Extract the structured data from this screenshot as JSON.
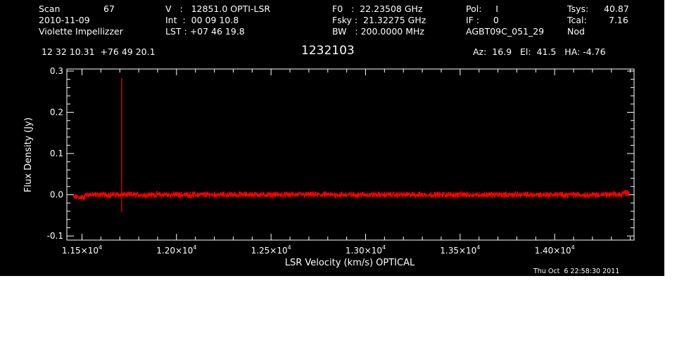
{
  "header": {
    "scan_label": "Scan",
    "scan_value": "67",
    "date": "2010-11-09",
    "observer": "Violette Impellizzer",
    "v_line": "V   :   12851.0 OPTI-LSR",
    "int_line": "Int  :  00 09 10.8",
    "lst_line": "LST : +07 46 19.8",
    "f0_line": "F0   :  22.23508 GHz",
    "fsky_line": "Fsky :  21.32275 GHz",
    "bw_line": "BW   : 200.0000 MHz",
    "pol_line": "Pol:     I",
    "if_line": "IF :     0",
    "project": "AGBT09C_051_29",
    "tsys_label": "Tsys:",
    "tsys_value": "40.87",
    "tcal_label": "Tcal:",
    "tcal_value": "7.16",
    "mode": "Nod",
    "coords": "12 32 10.31  +76 49 20.1",
    "source": "1232103",
    "azelha": "Az:  16.9   El:  41.5   HA: -4.76",
    "timestamp": "Thu Oct  6 22:58:30 2011"
  },
  "chart_data": {
    "type": "line",
    "title": "1232103",
    "xlabel": "LSR Velocity (km/s) OPTICAL",
    "ylabel": "Flux Density (Jy)",
    "xlim": [
      11420,
      14420
    ],
    "ylim": [
      -0.11,
      0.305
    ],
    "x_ticks": [
      {
        "value": 11500,
        "mantissa": "1.15",
        "exp": "4"
      },
      {
        "value": 12000,
        "mantissa": "1.20",
        "exp": "4"
      },
      {
        "value": 12500,
        "mantissa": "1.25",
        "exp": "4"
      },
      {
        "value": 13000,
        "mantissa": "1.30",
        "exp": "4"
      },
      {
        "value": 13500,
        "mantissa": "1.35",
        "exp": "4"
      },
      {
        "value": 14000,
        "mantissa": "1.40",
        "exp": "4"
      }
    ],
    "y_ticks": [
      {
        "value": 0.3,
        "label": "0.3"
      },
      {
        "value": 0.2,
        "label": "0.2"
      },
      {
        "value": 0.1,
        "label": "0.1"
      },
      {
        "value": 0.0,
        "label": "0.0"
      },
      {
        "value": -0.1,
        "label": "-0.1"
      }
    ],
    "grid": false,
    "series": [
      {
        "color": "#ff0000",
        "x_start": 11455,
        "x_end": 14395,
        "baseline": 0.0,
        "noise_amplitude": 0.006,
        "spike": {
          "x": 11710,
          "y_max": 0.283,
          "y_min": -0.043
        }
      }
    ]
  },
  "colors": {
    "panel_background": "#000000",
    "text_and_axes": "#ffffff",
    "spectrum": "#ff0000"
  }
}
